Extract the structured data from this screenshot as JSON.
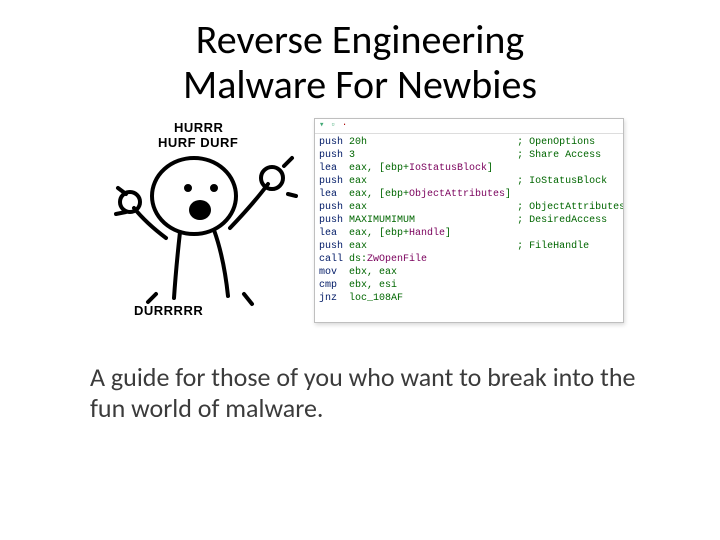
{
  "title_l1": "Reverse Engineering",
  "title_l2": "Malware For Newbies",
  "cartoon": {
    "top1": "HURRR",
    "top2": "HURF DURF",
    "bottom": "DURRRRR"
  },
  "toolbar": {
    "a": "▾",
    "b": "▫",
    "c": "·"
  },
  "code": [
    {
      "mn": "push",
      "op": "20h",
      "cm": "; OpenOptions"
    },
    {
      "mn": "push",
      "op": "3",
      "cm": "; Share Access"
    },
    {
      "mn": "lea",
      "op": "eax, [ebp+",
      "id": "IoStatusBlock",
      "tail": "]",
      "cm": ""
    },
    {
      "mn": "push",
      "op": "eax",
      "cm": "; IoStatusBlock"
    },
    {
      "mn": "lea",
      "op": "eax, [ebp+",
      "id": "ObjectAttributes",
      "tail": "]",
      "cm": ""
    },
    {
      "mn": "push",
      "op": "eax",
      "cm": "; ObjectAttributes"
    },
    {
      "mn": "push",
      "op": "MAXIMUMIMUM",
      "cm": "; DesiredAccess"
    },
    {
      "mn": "lea",
      "op": "eax, [ebp+",
      "id": "Handle",
      "tail": "]",
      "cm": ""
    },
    {
      "mn": "push",
      "op": "eax",
      "cm": "; FileHandle"
    },
    {
      "mn": "call",
      "op": "ds:",
      "id": "ZwOpenFile",
      "tail": "",
      "cm": ""
    },
    {
      "mn": "mov",
      "op": "ebx, eax",
      "cm": ""
    },
    {
      "mn": "cmp",
      "op": "ebx, esi",
      "cm": ""
    },
    {
      "mn": "jnz",
      "op": "loc_108AF",
      "cm": ""
    }
  ],
  "subtitle": "A guide for those of you who want to break into the fun world of malware."
}
